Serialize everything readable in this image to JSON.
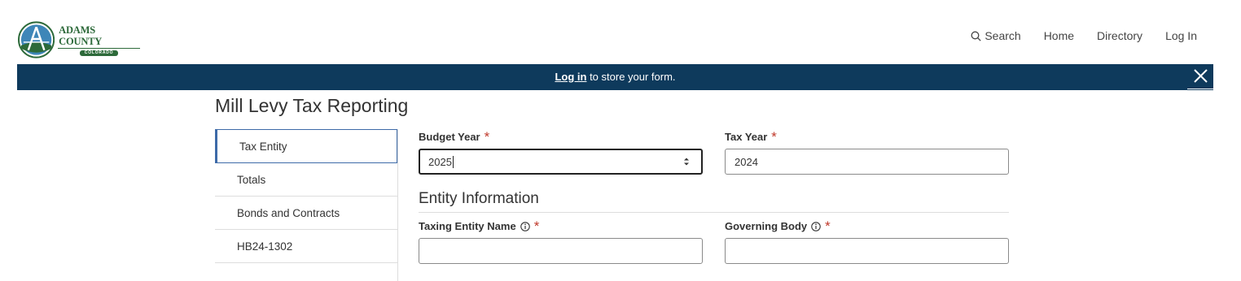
{
  "header": {
    "logo": {
      "name": "ADAMS COUNTY",
      "subtitle": "COLORADO"
    },
    "nav": [
      {
        "label": "Search",
        "icon": "search-icon"
      },
      {
        "label": "Home"
      },
      {
        "label": "Directory"
      },
      {
        "label": "Log In"
      }
    ]
  },
  "banner": {
    "link_text": "Log in",
    "message": " to store your form."
  },
  "page": {
    "title": "Mill Levy Tax Reporting"
  },
  "sidenav": {
    "items": [
      {
        "label": "Tax Entity",
        "active": true
      },
      {
        "label": "Totals"
      },
      {
        "label": "Bonds and Contracts"
      },
      {
        "label": "HB24-1302"
      }
    ]
  },
  "form": {
    "budget_year": {
      "label": "Budget Year",
      "value": "2025"
    },
    "tax_year": {
      "label": "Tax Year",
      "value": "2024"
    },
    "entity_section_title": "Entity Information",
    "taxing_entity_name": {
      "label": "Taxing Entity Name",
      "value": ""
    },
    "governing_body": {
      "label": "Governing Body",
      "value": ""
    },
    "required_marker": "*"
  },
  "colors": {
    "banner_bg": "#0e3a5c",
    "active_accent": "#3d6aa8",
    "required": "#c0392b",
    "brand_green": "#2d6a3a"
  }
}
